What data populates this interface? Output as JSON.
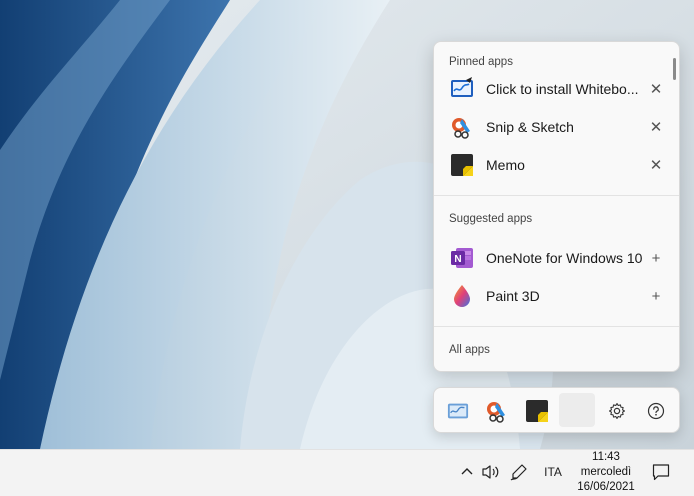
{
  "pen_menu": {
    "pinned_title": "Pinned apps",
    "pinned": [
      {
        "label": "Click to install Whitebo...",
        "icon": "whiteboard-icon",
        "action": "✕"
      },
      {
        "label": "Snip & Sketch",
        "icon": "snip-sketch-icon",
        "action": "✕"
      },
      {
        "label": "Memo",
        "icon": "memo-icon",
        "action": "✕"
      }
    ],
    "suggested_title": "Suggested apps",
    "suggested": [
      {
        "label": "OneNote for Windows 10",
        "icon": "onenote-icon",
        "action": "+"
      },
      {
        "label": "Paint 3D",
        "icon": "paint3d-icon",
        "action": "+"
      }
    ],
    "all_apps": "All apps"
  },
  "quick_bar": {
    "items": [
      "whiteboard-icon",
      "snip-sketch-icon",
      "memo-icon",
      "empty-slot",
      "gear-icon",
      "help-icon"
    ]
  },
  "taskbar": {
    "lang": "ITA",
    "time": "11:43",
    "day": "mercoledì",
    "date": "16/06/2021"
  },
  "colors": {
    "panel_bg": "#f9f9f9",
    "taskbar_bg": "#f3f3f3",
    "wallpaper_light": "#dfe8ee",
    "wallpaper_dark": "#1f4f82"
  }
}
